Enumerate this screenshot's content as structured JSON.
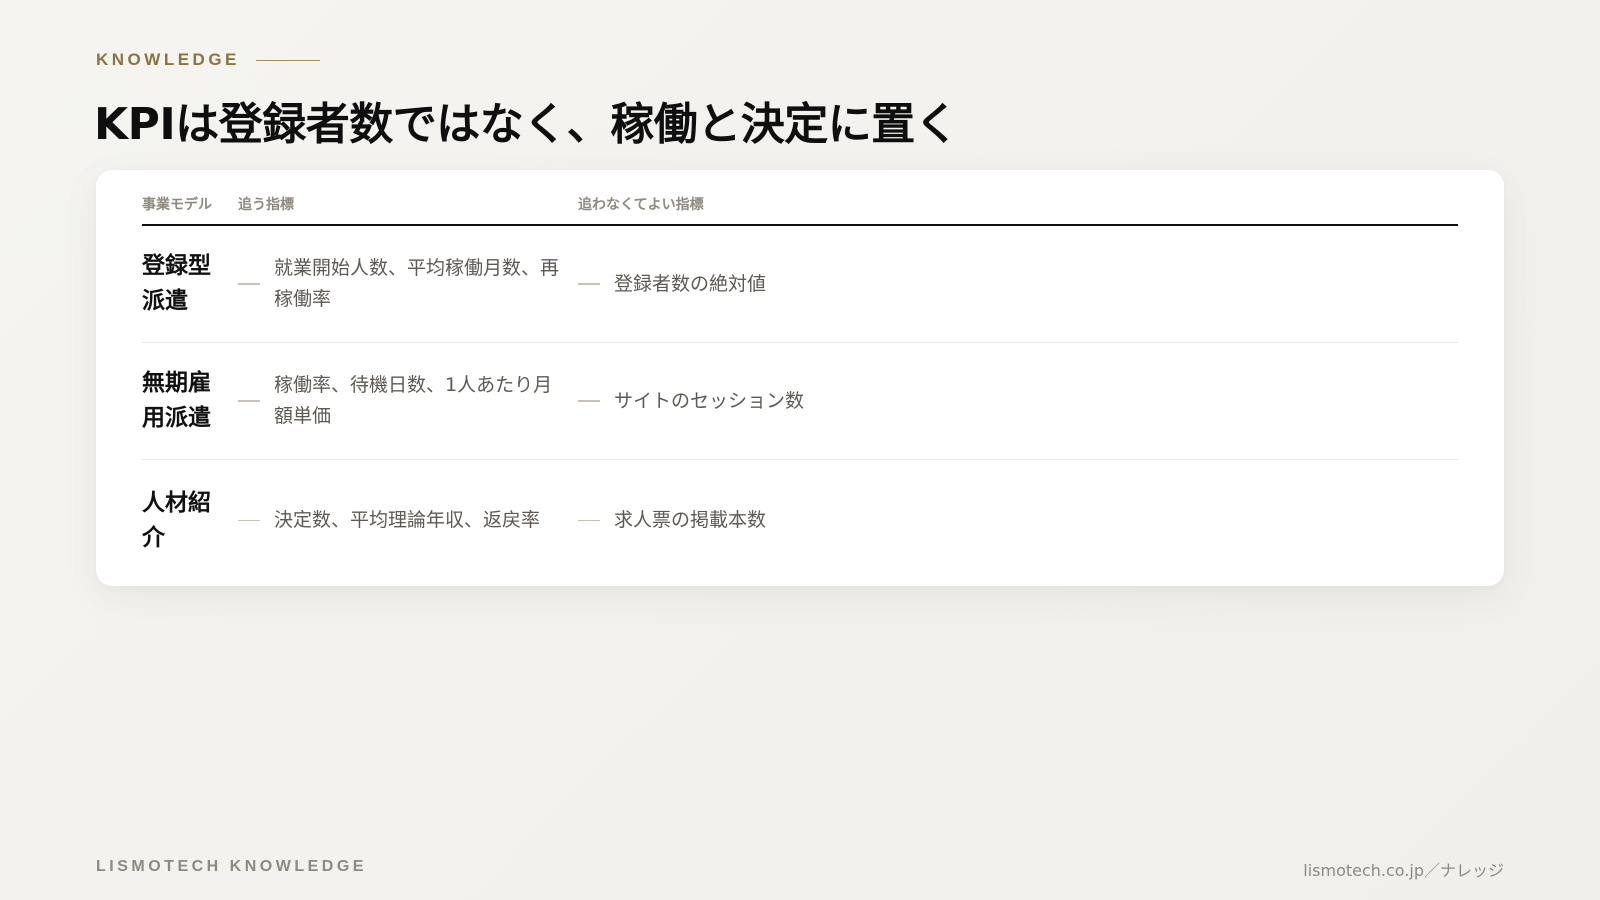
{
  "header": {
    "eyebrow": "KNOWLEDGE",
    "title": "KPIは登録者数ではなく、稼働と決定に置く"
  },
  "table": {
    "columns": [
      "事業モデル",
      "追う指標",
      "追わなくてよい指標"
    ],
    "rows": [
      {
        "model": "登録型派遣",
        "track": "就業開始人数、平均稼働月数、再稼働率",
        "ignore": "登録者数の絶対値"
      },
      {
        "model": "無期雇用派遣",
        "track": "稼働率、待機日数、1人あたり月額単価",
        "ignore": "サイトのセッション数"
      },
      {
        "model": "人材紹介",
        "track": "決定数、平均理論年収、返戻率",
        "ignore": "求人票の掲載本数"
      }
    ]
  },
  "footer": {
    "brand": "LISMOTECH KNOWLEDGE",
    "url": "lismotech.co.jp／ナレッジ"
  }
}
